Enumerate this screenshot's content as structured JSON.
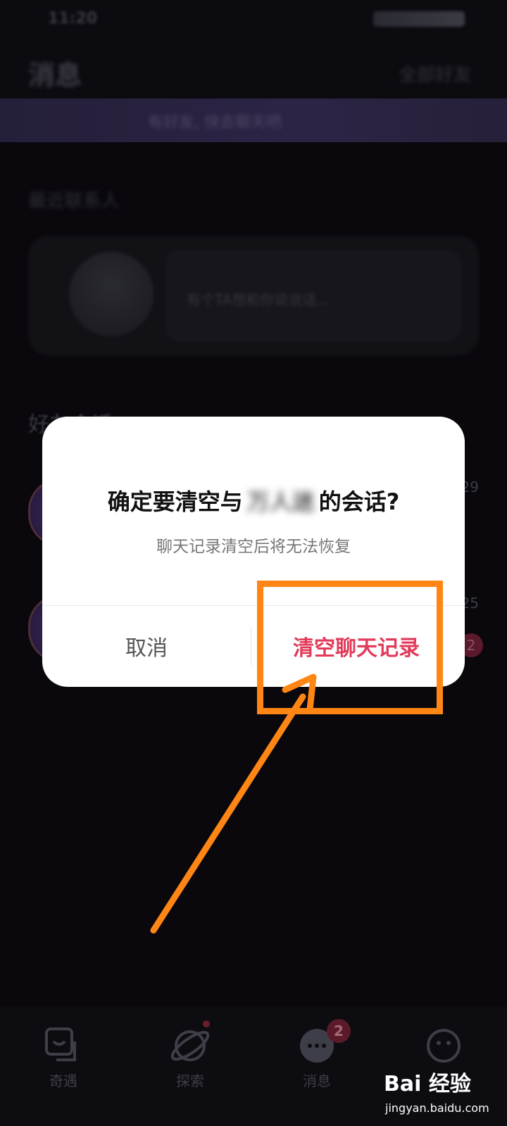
{
  "status_bar": {
    "time": "11:20"
  },
  "header": {
    "title": "消息",
    "action": "全部好友"
  },
  "banner": {
    "text": "有好友, 快去聊天吧"
  },
  "sections": {
    "recent_label": "最近联系人",
    "friends_label": "好友会话"
  },
  "card": {
    "message": "有个TA想和你说说话..."
  },
  "chat_rows": [
    {
      "time": "29"
    },
    {
      "time": "25",
      "badge": "2"
    }
  ],
  "dialog": {
    "title_prefix": "确定要清空与",
    "title_name": "万人迷",
    "title_suffix": "的会话?",
    "subtitle": "聊天记录清空后将无法恢复",
    "cancel_label": "取消",
    "confirm_label": "清空聊天记录"
  },
  "tabbar": {
    "tabs": [
      {
        "label": "奇遇",
        "icon": "encounter-icon"
      },
      {
        "label": "探索",
        "icon": "planet-icon",
        "dot": true
      },
      {
        "label": "消息",
        "icon": "chat-bubble-icon",
        "badge": "2"
      },
      {
        "label": "",
        "icon": "smile-icon"
      }
    ]
  },
  "watermark": {
    "brand": "Bai 经验",
    "url": "jingyan.baidu.com"
  },
  "colors": {
    "confirm": "#e23a5a",
    "annotation": "#ff8614",
    "banner": "#2c2445"
  }
}
